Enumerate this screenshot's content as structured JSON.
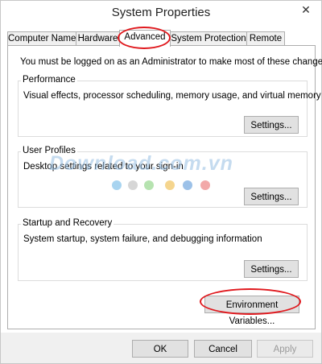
{
  "window": {
    "title": "System Properties",
    "close_glyph": "✕"
  },
  "tabs": [
    {
      "label": "Computer Name",
      "active": false
    },
    {
      "label": "Hardware",
      "active": false
    },
    {
      "label": "Advanced",
      "active": true
    },
    {
      "label": "System Protection",
      "active": false
    },
    {
      "label": "Remote",
      "active": false
    }
  ],
  "advanced": {
    "admin_note": "You must be logged on as an Administrator to make most of these changes.",
    "performance": {
      "legend": "Performance",
      "description": "Visual effects, processor scheduling, memory usage, and virtual memory",
      "button": "Settings..."
    },
    "user_profiles": {
      "legend": "User Profiles",
      "description": "Desktop settings related to your sign-in",
      "button": "Settings..."
    },
    "startup_recovery": {
      "legend": "Startup and Recovery",
      "description": "System startup, system failure, and debugging information",
      "button": "Settings..."
    },
    "env_button": "Environment Variables..."
  },
  "footer": {
    "ok": "OK",
    "cancel": "Cancel",
    "apply": "Apply"
  },
  "watermark": {
    "text": "Download.com.vn",
    "dot_colors": [
      "#a8d4f0",
      "#d6d6d6",
      "#b6e3b0",
      "#f5d58e",
      "#9cc1e8",
      "#f2a9a9"
    ]
  },
  "colors": {
    "highlight_ring": "#e0191e",
    "button_face": "#e1e1e1",
    "footer_bg": "#f0f0f0"
  }
}
